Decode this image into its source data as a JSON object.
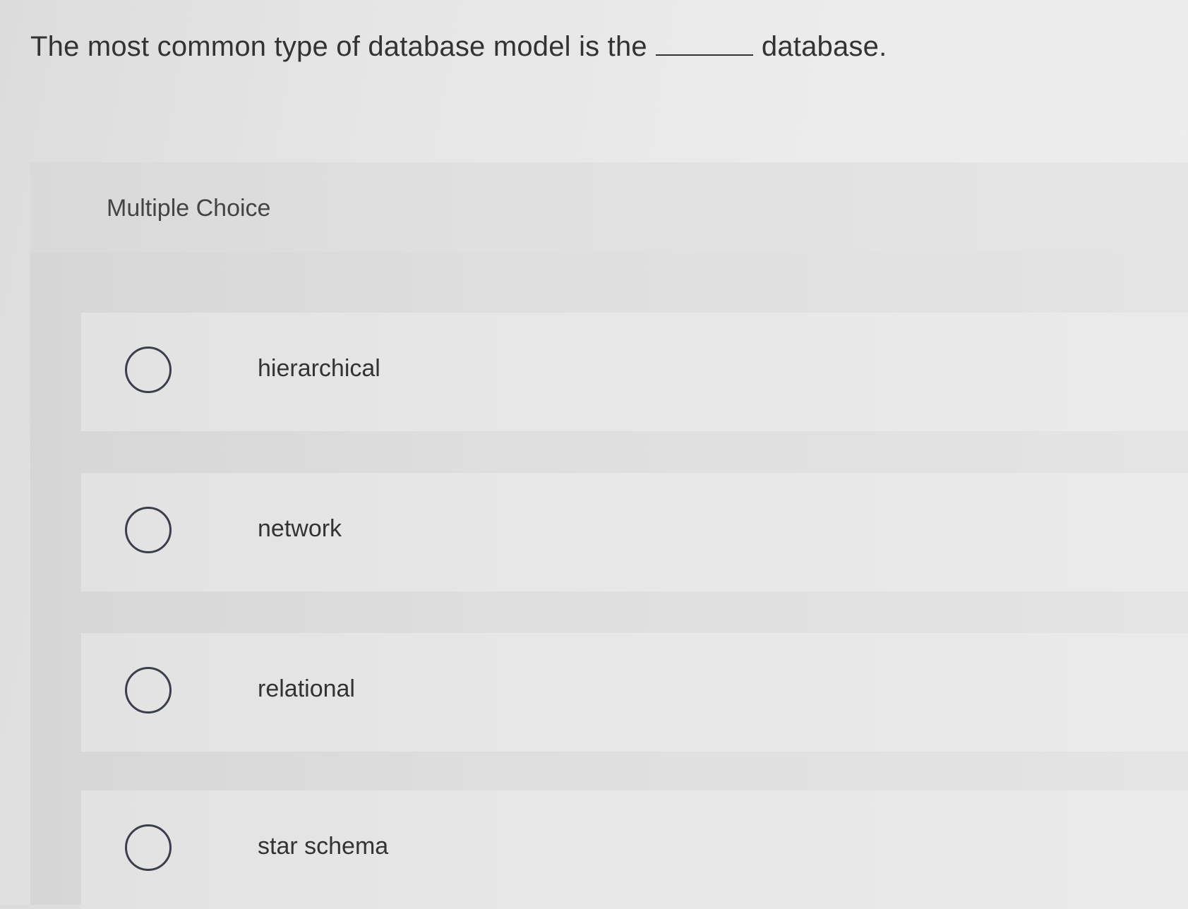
{
  "question": {
    "before_blank": "The most common type of database model is the",
    "after_blank": "database."
  },
  "panel": {
    "label": "Multiple Choice"
  },
  "options": [
    {
      "label": "hierarchical",
      "selected": false
    },
    {
      "label": "network",
      "selected": false
    },
    {
      "label": "relational",
      "selected": false
    },
    {
      "label": "star schema",
      "selected": false
    }
  ]
}
